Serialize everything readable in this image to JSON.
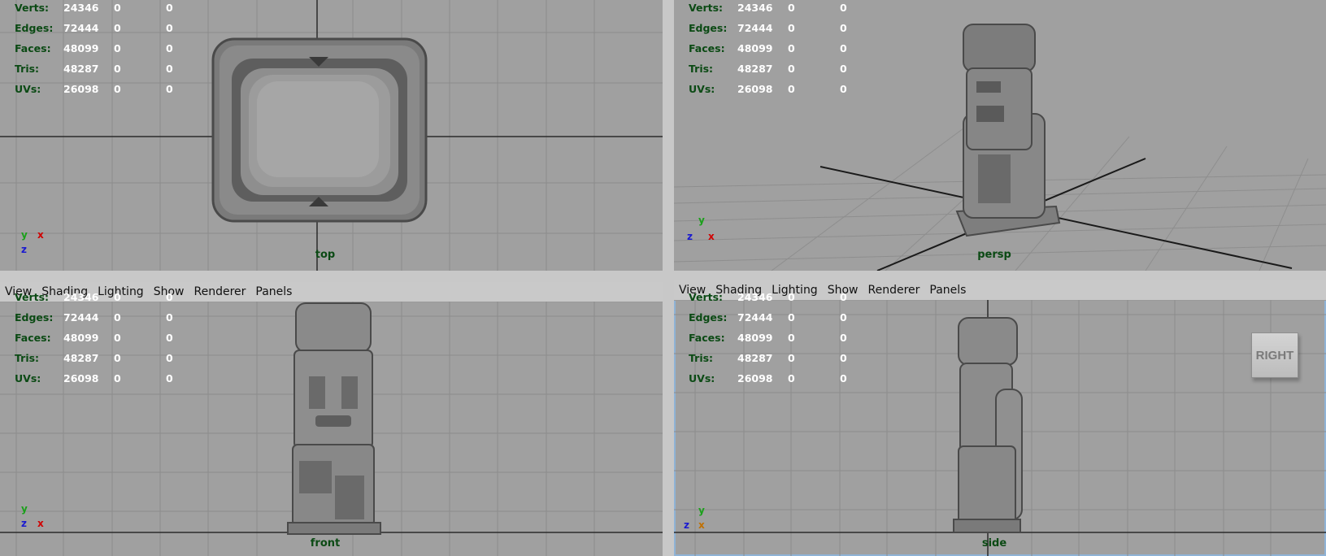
{
  "menu": [
    "View",
    "Shading",
    "Lighting",
    "Show",
    "Renderer",
    "Panels"
  ],
  "hud": {
    "rows": [
      {
        "label": "Verts:",
        "v1": "24346",
        "v2": "0",
        "v3": "0"
      },
      {
        "label": "Edges:",
        "v1": "72444",
        "v2": "0",
        "v3": "0"
      },
      {
        "label": "Faces:",
        "v1": "48099",
        "v2": "0",
        "v3": "0"
      },
      {
        "label": "Tris:",
        "v1": "48287",
        "v2": "0",
        "v3": "0"
      },
      {
        "label": "UVs:",
        "v1": "26098",
        "v2": "0",
        "v3": "0"
      }
    ]
  },
  "viewports": {
    "top": {
      "camera": "top",
      "axes": [
        "y",
        "x",
        "z"
      ]
    },
    "persp": {
      "camera": "persp",
      "axes": [
        "y",
        "z",
        "x"
      ]
    },
    "front": {
      "camera": "front",
      "axes": [
        "y",
        "z",
        "x"
      ]
    },
    "side": {
      "camera": "side",
      "axes": [
        "y",
        "z",
        "x"
      ]
    }
  },
  "view_cube": {
    "label": "RIGHT"
  },
  "colors": {
    "viewport_bg": "#a0a0a0",
    "label_green": "#0b4a14",
    "active_border": "#8fb3d6"
  }
}
